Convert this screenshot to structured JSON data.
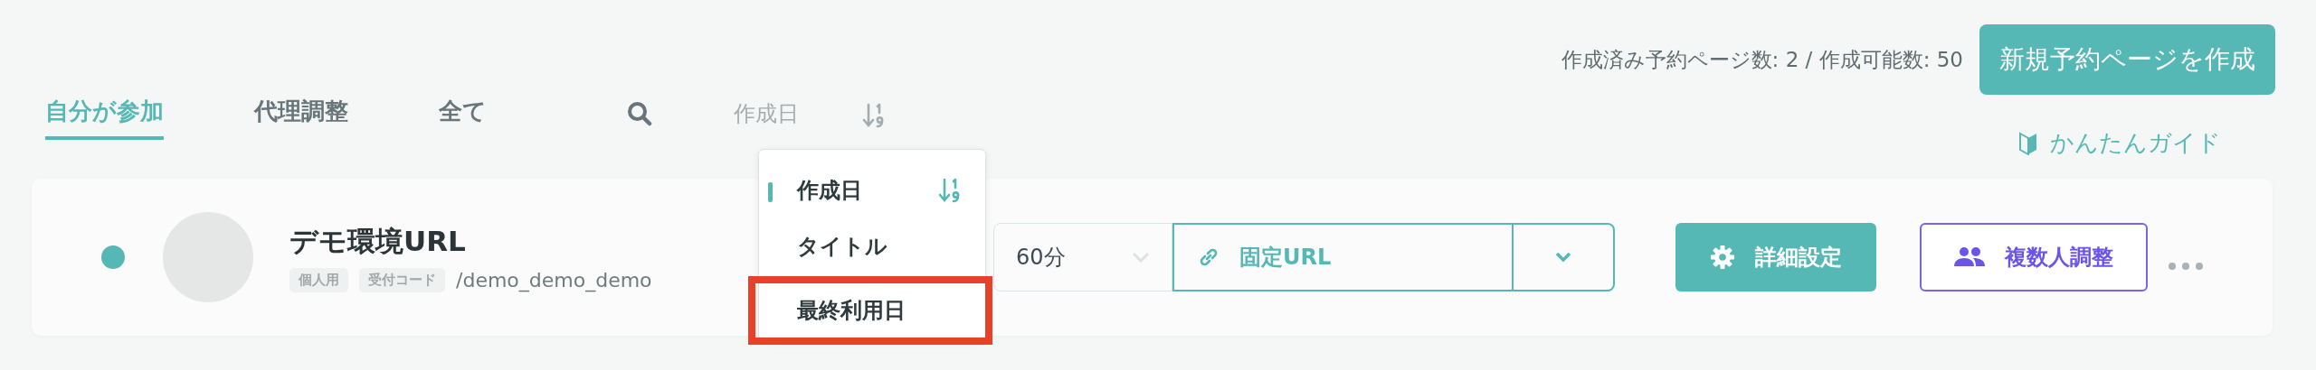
{
  "tabs": [
    {
      "label": "自分が参加",
      "selected": true
    },
    {
      "label": "代理調整",
      "selected": false
    },
    {
      "label": "全て",
      "selected": false
    }
  ],
  "sort": {
    "field": "作成日",
    "options": [
      {
        "label": "作成日",
        "selected": true,
        "highlighted": false
      },
      {
        "label": "タイトル",
        "selected": false,
        "highlighted": false
      },
      {
        "label": "最終利用日",
        "selected": false,
        "highlighted": true
      }
    ]
  },
  "quota": "作成済み予約ページ数: 2 / 作成可能数: 50",
  "create_button": "新規予約ページを作成",
  "guide_link": "かんたんガイド",
  "pages": [
    {
      "color": "#56b8b4",
      "title": "デモ環境URL",
      "tags": [
        "個人用",
        "受付コード"
      ],
      "path": "/demo_demo_demo",
      "duration": "60分",
      "url_type": "固定URL",
      "settings_button": "詳細設定",
      "group_button": "複数人調整"
    }
  ]
}
